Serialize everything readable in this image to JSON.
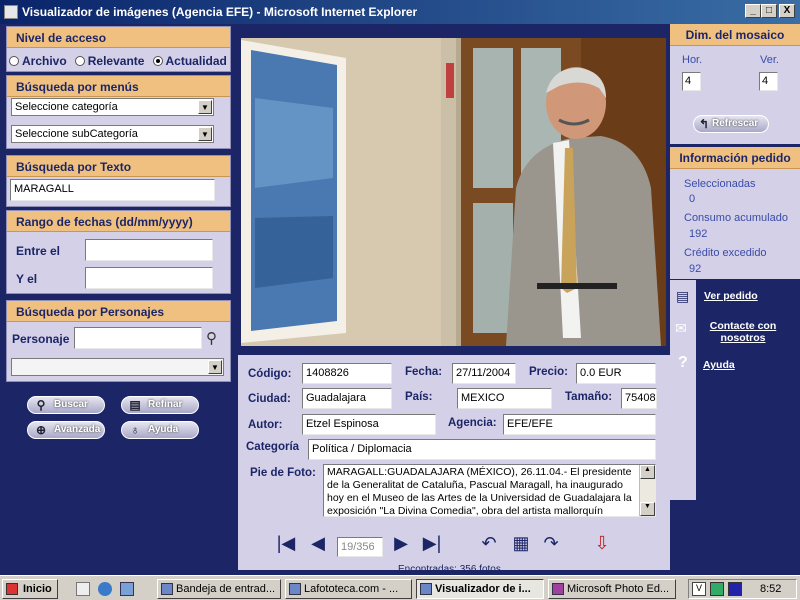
{
  "window": {
    "title": "Visualizador de imágenes (Agencia EFE) - Microsoft Internet Explorer",
    "btn_min": "_",
    "btn_max": "□",
    "btn_close": "X"
  },
  "left": {
    "nivel": {
      "header": "Nivel de acceso",
      "options": [
        "Archivo",
        "Relevante",
        "Actualidad"
      ],
      "selected": "Actualidad"
    },
    "menus": {
      "header": "Búsqueda por menús",
      "categoria": "Seleccione categoría",
      "subcategoria": "Seleccione subCategoría"
    },
    "texto": {
      "header": "Búsqueda por Texto",
      "value": "MARAGALL"
    },
    "fechas": {
      "header": "Rango de fechas (dd/mm/yyyy)",
      "entre_label": "Entre el",
      "y_label": "Y el",
      "entre_value": "",
      "y_value": ""
    },
    "personajes": {
      "header": "Búsqueda por Personajes",
      "label": "Personaje",
      "value": "",
      "select_value": ""
    },
    "buttons": {
      "buscar": "Buscar",
      "refinar": "Refinar",
      "avanzada": "Avanzada",
      "ayuda": "Ayuda"
    }
  },
  "info": {
    "codigo_label": "Código:",
    "codigo": "1408826",
    "fecha_label": "Fecha:",
    "fecha": "27/11/2004",
    "precio_label": "Precio:",
    "precio": "0.0  EUR",
    "ciudad_label": "Ciudad:",
    "ciudad": "Guadalajara",
    "pais_label": "País:",
    "pais": "MEXICO",
    "tamano_label": "Tamaño:",
    "tamano": "75408",
    "autor_label": "Autor:",
    "autor": "Etzel Espinosa",
    "agencia_label": "Agencia:",
    "agencia": "EFE/EFE",
    "categoria_label": "Categoría",
    "categoria": "Política / Diplomacia",
    "pie_label": "Pie de Foto:",
    "pie": "MARAGALL:GUADALAJARA (MÉXICO), 26.11.04.- El presidente de la Generalitat de Cataluña, Pascual Maragall, ha inaugurado hoy en el Museo de las Artes de la Universidad de Guadalajara la exposición \"La Divina Comedia\", obra del artista mallorquín"
  },
  "nav": {
    "counter": "19/356",
    "footer": "Encontradas: 356 fotos"
  },
  "right": {
    "mosaico": {
      "header": "Dim. del mosaico",
      "hor_label": "Hor.",
      "ver_label": "Ver.",
      "hor": "4",
      "ver": "4",
      "refresh": "Refrescar"
    },
    "pedido": {
      "header": "Información pedido",
      "sel_label": "Seleccionadas",
      "sel": "0",
      "consumo_label": "Consumo acumulado",
      "consumo": "192",
      "credito_label": "Crédito excedido",
      "credito": "92"
    },
    "links": {
      "ver_pedido": "Ver pedido",
      "contacte1": "Contacte con",
      "contacte2": "nosotros",
      "ayuda": "Ayuda"
    }
  },
  "taskbar": {
    "start": "Inicio",
    "items": [
      "Bandeja de entrad...",
      "Lafototeca.com - ...",
      "Visualizador de i...",
      "Microsoft Photo Ed..."
    ],
    "clock": "8:52"
  }
}
